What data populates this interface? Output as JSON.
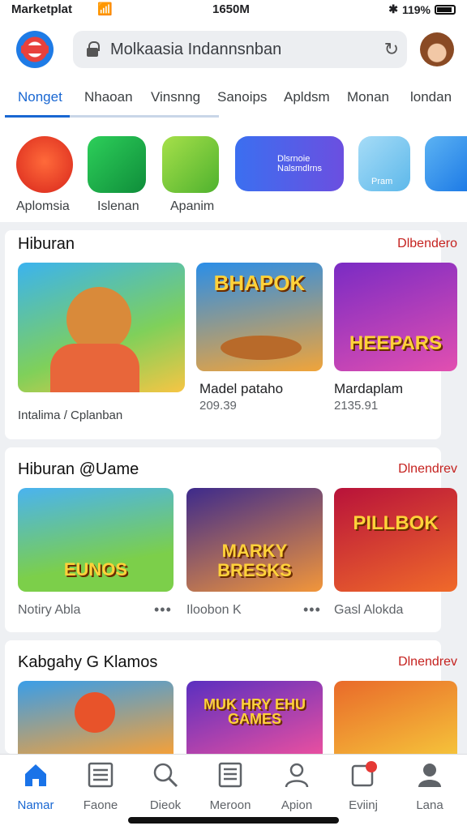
{
  "status_bar": {
    "carrier": "Marketplat",
    "time": "1650M",
    "battery": "119%"
  },
  "header": {
    "search_text": "Molkaasia Indannsnban",
    "tabs": [
      "Nonget",
      "Nhaoan",
      "Vinsnng",
      "Sanoips",
      "Apldsm",
      "Monan",
      "londan"
    ],
    "active_tab": 0
  },
  "apps": [
    {
      "label": "Aplomsia",
      "color": "#e8412c"
    },
    {
      "label": "Islenan",
      "color": "#1ea84a"
    },
    {
      "label": "Apanim",
      "color": "#8bd23a"
    },
    {
      "label": "Dlsrnoie Nalsmdlrns",
      "color": "#4b5fe0"
    },
    {
      "label": "Pram",
      "color": "#7dc8ef"
    },
    {
      "label": "",
      "color": "#2e8fe6"
    }
  ],
  "sections": [
    {
      "title": "Hiburan",
      "more": "Dlbendero",
      "items": [
        {
          "art_text": "",
          "caption": "Intalima / Cplanban",
          "price": "",
          "colors": [
            "#3bb3ef",
            "#f7c544"
          ]
        },
        {
          "art_text": "BHAPOK",
          "caption": "Madel pataho",
          "price": "209.39",
          "colors": [
            "#2a8ee8",
            "#f0a43a"
          ]
        },
        {
          "art_text": "HEEPARS",
          "caption": "Mardaplam",
          "price": "2135.91",
          "colors": [
            "#7a2bc4",
            "#e24fb0"
          ]
        }
      ]
    },
    {
      "title": "Hiburan @Uame",
      "more": "Dlnendrev",
      "items": [
        {
          "art_text": "EUNOS",
          "caption": "Notiry Abla",
          "price": "",
          "colors": [
            "#4ab3f0",
            "#7ccf4a"
          ]
        },
        {
          "art_text": "MARKY BRESKS",
          "caption": "Iloobon K",
          "price": "",
          "colors": [
            "#3d2a8c",
            "#f2963a"
          ]
        },
        {
          "art_text": "PILLBOK",
          "caption": "Gasl Alokda",
          "price": "",
          "colors": [
            "#b8123a",
            "#f06a2a"
          ]
        }
      ]
    },
    {
      "title": "Kabgahy G Klamos",
      "more": "Dlnendrev",
      "items": [
        {
          "art_text": "",
          "caption": "",
          "price": "",
          "colors": [
            "#3a9ee8",
            "#f3a03a"
          ]
        },
        {
          "art_text": "MUK HRY EHU GAMES",
          "caption": "",
          "price": "",
          "colors": [
            "#5a2fc0",
            "#e84fa0"
          ]
        },
        {
          "art_text": "",
          "caption": "",
          "price": "",
          "colors": [
            "#e96a2a",
            "#f5c23a"
          ]
        }
      ]
    }
  ],
  "bottom_nav": [
    {
      "label": "Namar",
      "icon": "home-icon"
    },
    {
      "label": "Faone",
      "icon": "list-icon"
    },
    {
      "label": "Dieok",
      "icon": "search-icon"
    },
    {
      "label": "Meroon",
      "icon": "news-icon"
    },
    {
      "label": "Apion",
      "icon": "person-icon"
    },
    {
      "label": "Eviinj",
      "icon": "notification-icon"
    },
    {
      "label": "Lana",
      "icon": "account-icon"
    }
  ],
  "accent_color": "#1967d2",
  "more_color": "#c5221f"
}
